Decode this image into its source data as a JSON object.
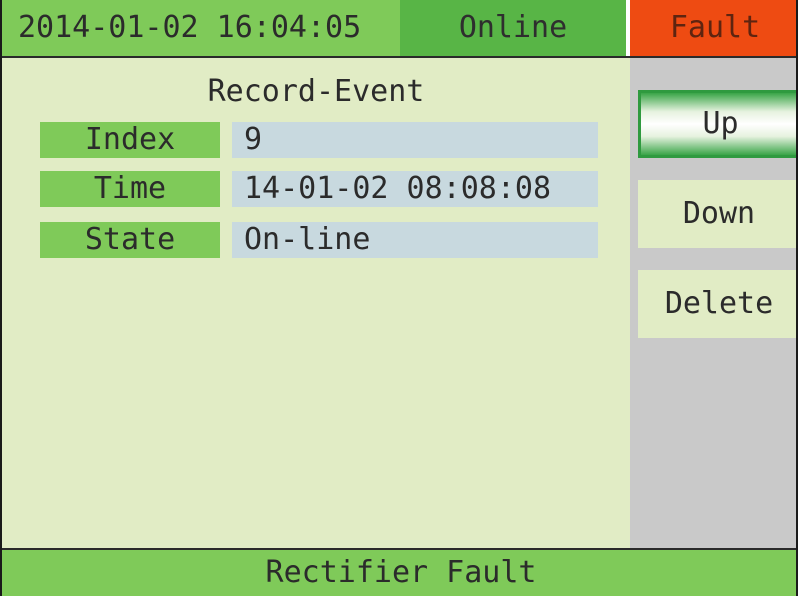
{
  "header": {
    "datetime": "2014-01-02 16:04:05",
    "status_online": "Online",
    "status_fault": "Fault"
  },
  "record": {
    "title": "Record-Event",
    "fields": [
      {
        "label": "Index",
        "value": "9"
      },
      {
        "label": "Time",
        "value": "14-01-02 08:08:08"
      },
      {
        "label": "State",
        "value": "On-line"
      }
    ]
  },
  "buttons": {
    "up": "Up",
    "down": "Down",
    "delete": "Delete"
  },
  "footer": {
    "message": "Rectifier Fault"
  },
  "colors": {
    "green": "#7fca59",
    "online_green": "#58b546",
    "fault_orange": "#ee4b12",
    "panel": "#e1ecc5",
    "value_bg": "#c8d9df",
    "side_gray": "#c9c9c9"
  }
}
